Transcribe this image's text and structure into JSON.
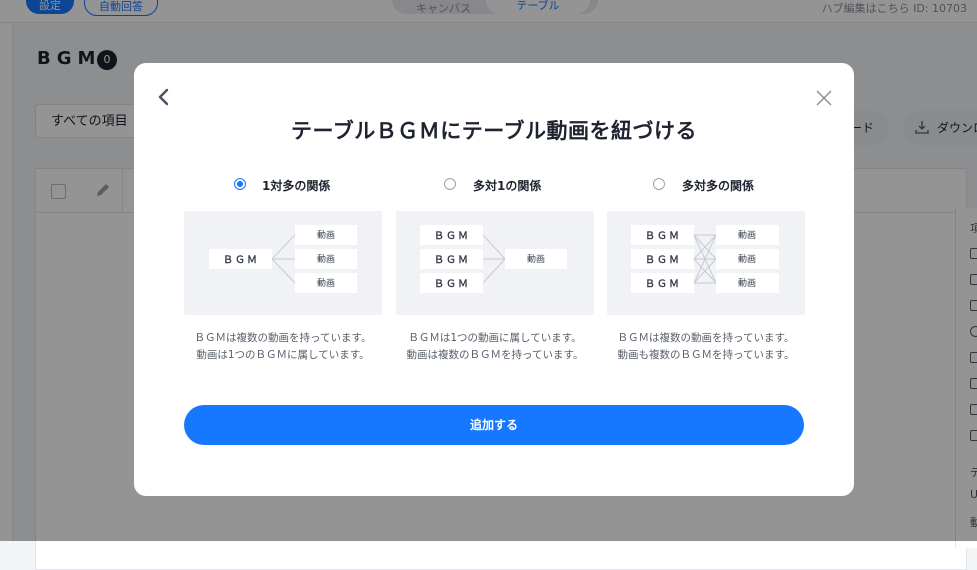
{
  "background": {
    "topbar": {
      "primary_button": "設定",
      "outline_button": "自動回答",
      "toggle_left": "キャンバス",
      "toggle_right": "テーブル",
      "meta": "ハブ編集はこちら  ID: 10703"
    },
    "page_title": "BGM",
    "page_count": "0",
    "filter_select": "すべての項目",
    "download_button_1": "ード",
    "download_button_2": "ダウンロ",
    "right_panel_items": [
      "項",
      "デ",
      "U",
      "動"
    ]
  },
  "modal": {
    "title": "テーブルＢＧＭにテーブル動画を紐づける",
    "options": [
      {
        "label": "1対多の関係",
        "checked": true,
        "left_boxes": [
          "ＢＧＭ"
        ],
        "right_boxes": [
          "動画",
          "動画",
          "動画"
        ],
        "description_line1": "ＢＧＭは複数の動画を持っています。",
        "description_line2": "動画は1つのＢＧＭに属しています。"
      },
      {
        "label": "多対1の関係",
        "checked": false,
        "left_boxes": [
          "ＢＧＭ",
          "ＢＧＭ",
          "ＢＧＭ"
        ],
        "right_boxes": [
          "動画"
        ],
        "description_line1": "ＢＧＭは1つの動画に属しています。",
        "description_line2": "動画は複数のＢＧＭを持っています。"
      },
      {
        "label": "多対多の関係",
        "checked": false,
        "left_boxes": [
          "ＢＧＭ",
          "ＢＧＭ",
          "ＢＧＭ"
        ],
        "right_boxes": [
          "動画",
          "動画",
          "動画"
        ],
        "description_line1": "ＢＧＭは複数の動画を持っています。",
        "description_line2": "動画も複数のＢＧＭを持っています。"
      }
    ],
    "submit_label": "追加する"
  },
  "colors": {
    "accent": "#1677ff",
    "overlay": "rgba(0,0,0,0.42)",
    "diagram_bg": "#f1f2f5"
  }
}
